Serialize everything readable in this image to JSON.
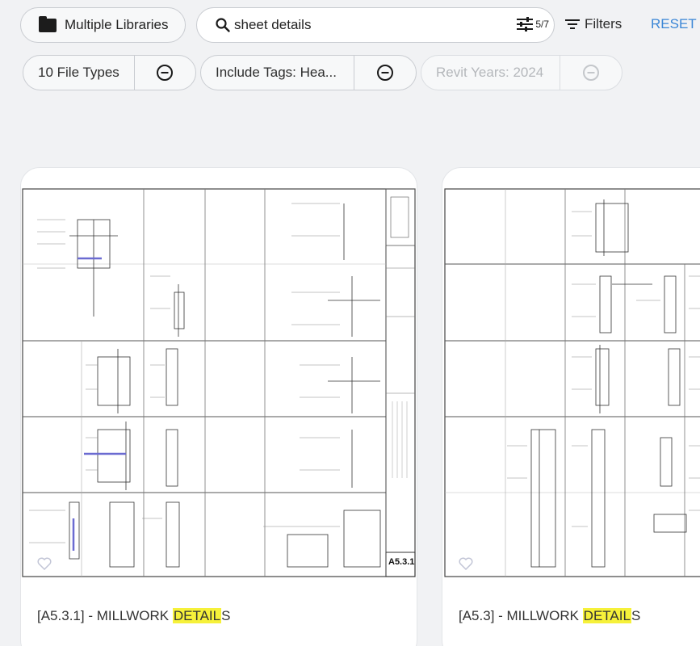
{
  "toolbar": {
    "library_button": "Multiple Libraries",
    "search_value": "sheet details",
    "search_placeholder": "Search",
    "advanced_count": "5/7",
    "filters_label": "Filters",
    "reset_label": "RESET"
  },
  "chips": [
    {
      "label": "10 File Types",
      "enabled": true
    },
    {
      "label": "Include Tags: Hea...",
      "enabled": true
    },
    {
      "label": "Revit Years: 2024",
      "enabled": false
    }
  ],
  "results": [
    {
      "prefix": "[A5.3.1] - MILLWORK ",
      "highlight": "DETAIL",
      "suffix": "S",
      "sheet_number": "A5.3.1"
    },
    {
      "prefix": "[A5.3] - MILLWORK ",
      "highlight": "DETAIL",
      "suffix": "S"
    }
  ],
  "colors": {
    "accent": "#3a86d6",
    "highlight": "#f6f13a",
    "background": "#f1f2f4"
  },
  "icons": [
    "folder-icon",
    "search-icon",
    "sliders-icon",
    "filter-icon",
    "remove-circle-icon",
    "heart-icon"
  ]
}
